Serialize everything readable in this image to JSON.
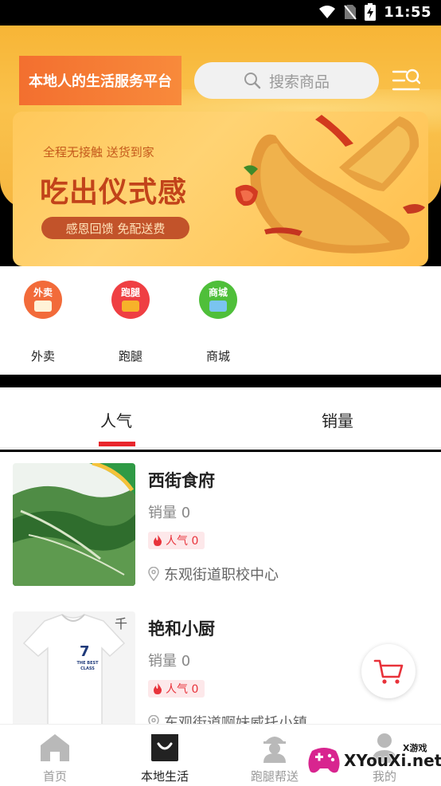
{
  "status_bar": {
    "time": "11:55"
  },
  "header": {
    "slogan": "本地人的生活服务平台",
    "search": {
      "placeholder": "搜索商品"
    }
  },
  "banner": {
    "subtitle": "全程无接触 送货到家",
    "title": "吃出仪式感",
    "pill": "感恩回馈 免配送费"
  },
  "categories": [
    {
      "label": "外卖",
      "icon_text": "外卖",
      "color": "#f26b3a",
      "icon": "takeout-icon"
    },
    {
      "label": "跑腿",
      "icon_text": "跑腿",
      "color": "#ef3f43",
      "icon": "errand-icon"
    },
    {
      "label": "商城",
      "icon_text": "商城",
      "color": "#4fbf3a",
      "icon": "mall-icon"
    }
  ],
  "tabs": [
    {
      "label": "人气",
      "active": true
    },
    {
      "label": "销量",
      "active": false
    }
  ],
  "shops": [
    {
      "name": "西街食府",
      "sales": "销量 0",
      "popularity": "人气 0",
      "address": "东观街道职校中心"
    },
    {
      "name": "艳和小厨",
      "sales": "销量 0",
      "popularity": "人气 0",
      "address": "东观街道啊妹威托小镇"
    }
  ],
  "thumb_texts": {
    "shirt_number": "7",
    "shirt_caption": "THE BEST CLASS",
    "shirt_tag": "千"
  },
  "bottom_nav": [
    {
      "label": "首页",
      "icon": "home-icon",
      "active": false
    },
    {
      "label": "本地生活",
      "icon": "shopping-bag-icon",
      "active": true
    },
    {
      "label": "跑腿帮送",
      "icon": "courier-icon",
      "active": false
    },
    {
      "label": "我的",
      "icon": "profile-icon",
      "active": false
    }
  ],
  "watermark": {
    "main": "XYouXi.net",
    "sub": "X游戏"
  },
  "colors": {
    "accent": "#e8272d",
    "header_yellow": "#f8bb3f",
    "banner_title": "#c2431a"
  }
}
